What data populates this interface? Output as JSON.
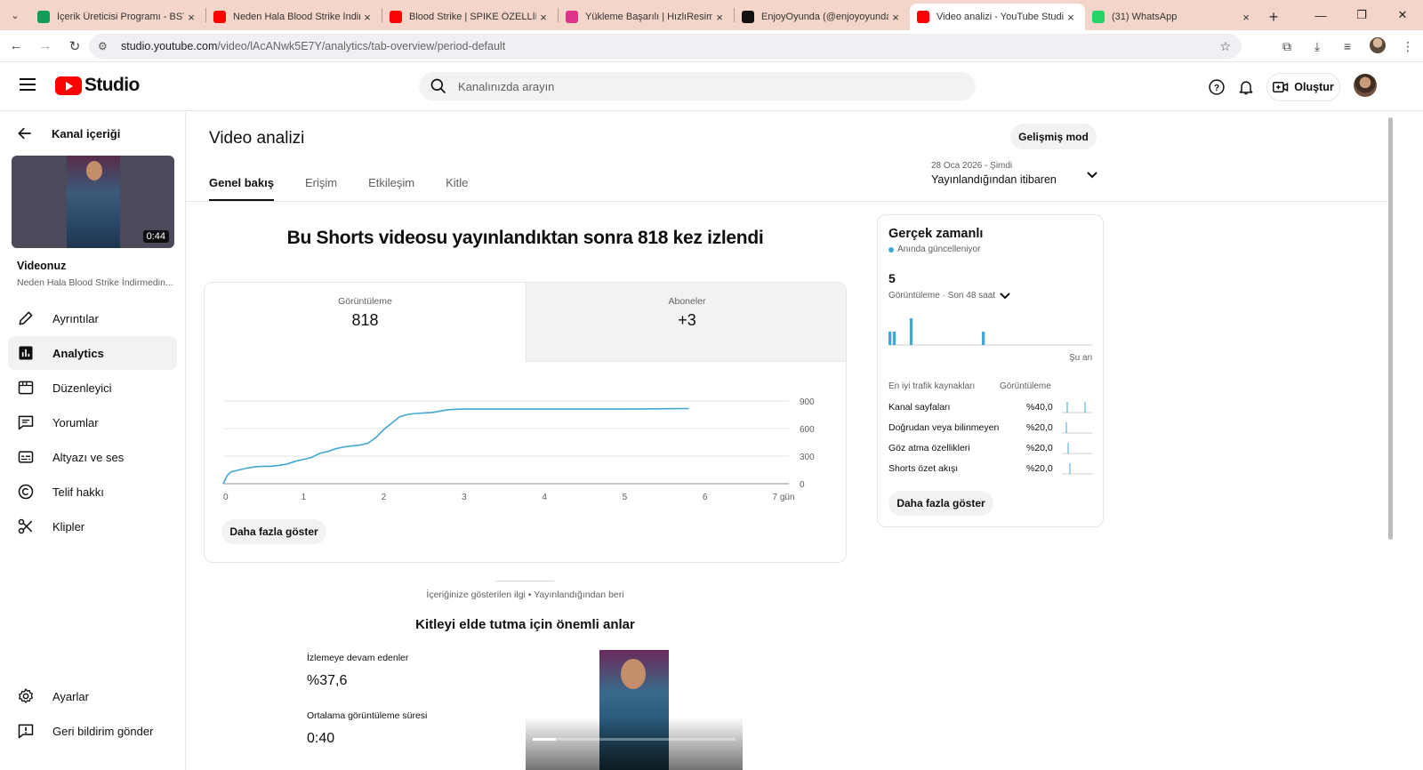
{
  "browser": {
    "tabs": [
      {
        "title": "İçerik Üreticisi Programı - BSTR",
        "favicon_color": "#0f9d58",
        "active": false
      },
      {
        "title": "Neden Hala Blood Strike İndirm",
        "favicon_color": "#ff0000",
        "active": false
      },
      {
        "title": "Blood Strike | SPIKE ÖZELLİKLER",
        "favicon_color": "#ff0000",
        "active": false
      },
      {
        "title": "Yükleme Başarılı | HızlıResim",
        "favicon_color": "#e0338a",
        "active": false
      },
      {
        "title": "EnjoyOyunda (@enjoyoyunda)",
        "favicon_color": "#111111",
        "active": false
      },
      {
        "title": "Video analizi - YouTube Studio",
        "favicon_color": "#ff0000",
        "active": true
      },
      {
        "title": "(31) WhatsApp",
        "favicon_color": "#25d366",
        "active": false
      }
    ],
    "url_host": "studio.youtube.com",
    "url_path": "/video/lAcANwk5E7Y/analytics/tab-overview/period-default"
  },
  "header": {
    "logo_text": "Studio",
    "search_placeholder": "Kanalınızda arayın",
    "create_label": "Oluştur"
  },
  "sidebar": {
    "back_label": "Kanal içeriği",
    "thumbnail_duration": "0:44",
    "your_video_label": "Videonuz",
    "video_title": "Neden Hala Blood Strike İndirmedin...",
    "items": [
      {
        "label": "Ayrıntılar",
        "icon": "pencil-icon",
        "active": false
      },
      {
        "label": "Analytics",
        "icon": "analytics-icon",
        "active": true
      },
      {
        "label": "Düzenleyici",
        "icon": "editor-icon",
        "active": false
      },
      {
        "label": "Yorumlar",
        "icon": "comment-icon",
        "active": false
      },
      {
        "label": "Altyazı ve ses",
        "icon": "subtitles-icon",
        "active": false
      },
      {
        "label": "Telif hakkı",
        "icon": "copyright-icon",
        "active": false
      },
      {
        "label": "Klipler",
        "icon": "scissors-icon",
        "active": false
      }
    ],
    "settings_label": "Ayarlar",
    "feedback_label": "Geri bildirim gönder"
  },
  "main": {
    "title": "Video analizi",
    "advanced_mode_label": "Gelişmiş mod",
    "tabs": [
      "Genel bakış",
      "Erişim",
      "Etkileşim",
      "Kitle"
    ],
    "active_tab": "Genel bakış",
    "period_small": "28 Oca 2026 - Şimdi",
    "period_label": "Yayınlandığından itibaren",
    "headline": "Bu Shorts videosu yayınlandıktan sonra 818 kez izlendi",
    "metrics": [
      {
        "label": "Görüntüleme",
        "value": "818"
      },
      {
        "label": "Aboneler",
        "value": "+3"
      }
    ],
    "show_more_label": "Daha fazla göster",
    "interest_label": "İçeriğinize gösterilen ilgi • Yayınlandığından beri",
    "key_moments_title": "Kitleyi elde tutma için önemli anlar",
    "retention_label": "İzlemeye devam edenler",
    "retention_value": "%37,6",
    "avg_duration_label": "Ortalama görüntüleme süresi",
    "avg_duration_value": "0:40"
  },
  "realtime": {
    "title": "Gerçek zamanlı",
    "live_label": "Anında güncelleniyor",
    "count": "5",
    "sub_label": "Görüntüleme · Son 48 saat",
    "now_label": "Şu an",
    "col_source": "En iyi trafik kaynakları",
    "col_views": "Görüntüleme",
    "sources": [
      {
        "label": "Kanal sayfaları",
        "pct": "%40,0"
      },
      {
        "label": "Doğrudan veya bilinmeyen",
        "pct": "%20,0"
      },
      {
        "label": "Göz atma özellikleri",
        "pct": "%20,0"
      },
      {
        "label": "Shorts özet akışı",
        "pct": "%20,0"
      }
    ],
    "show_more_label": "Daha fazla göster"
  },
  "chart_data": {
    "type": "line",
    "x": [
      0,
      0.05,
      0.1,
      0.2,
      0.3,
      0.4,
      0.5,
      0.6,
      0.7,
      0.8,
      0.9,
      1.0,
      1.1,
      1.2,
      1.3,
      1.4,
      1.5,
      1.6,
      1.7,
      1.8,
      1.9,
      2.0,
      2.1,
      2.2,
      2.3,
      2.4,
      2.5,
      2.6,
      2.7,
      2.8,
      2.9,
      3.0,
      3.5,
      4.0,
      4.5,
      5.0,
      5.4,
      5.8
    ],
    "values": [
      0,
      90,
      130,
      150,
      170,
      185,
      190,
      190,
      200,
      215,
      245,
      265,
      285,
      330,
      350,
      380,
      400,
      410,
      420,
      440,
      500,
      590,
      660,
      730,
      755,
      765,
      770,
      775,
      790,
      805,
      810,
      812,
      812,
      812,
      812,
      812,
      815,
      818
    ],
    "series_color": "#41a7d3",
    "x_ticks": [
      "0",
      "1",
      "2",
      "3",
      "4",
      "5",
      "6",
      "7 gün"
    ],
    "y_ticks": [
      "0",
      "300",
      "600",
      "900"
    ],
    "xlim": [
      0,
      7
    ],
    "ylim": [
      0,
      900
    ],
    "grid": true
  },
  "realtime_chart": {
    "type": "bar",
    "bars": [
      {
        "hour": 0,
        "views": 1
      },
      {
        "hour": 1,
        "views": 1
      },
      {
        "hour": 5,
        "views": 2
      },
      {
        "hour": 22,
        "views": 1
      }
    ],
    "max": 2,
    "color": "#41a7d3"
  }
}
